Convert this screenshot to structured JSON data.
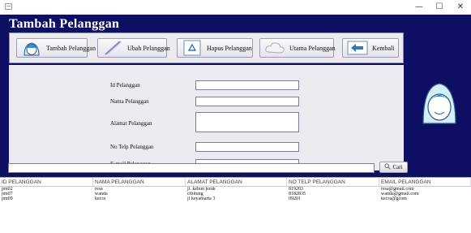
{
  "window": {
    "minimize": "—",
    "maximize": "☐",
    "close": "✕"
  },
  "page_title": "Tambah Pelanggan",
  "toolbar": {
    "buttons": [
      {
        "label": "Tambah Pelanggan",
        "icon": "customer-avatar-icon"
      },
      {
        "label": "Ubah Pelanggan",
        "icon": "pencil-icon"
      },
      {
        "label": "Hapus Pelanggan",
        "icon": "recycle-icon"
      },
      {
        "label": "Utama Pelanggan",
        "icon": "cloud-icon"
      },
      {
        "label": "Kembali",
        "icon": "back-arrow-icon"
      }
    ]
  },
  "form": {
    "id_label": "Id Pelanggan",
    "name_label": "Nama Pelanggan",
    "address_label": "Alamat Pelanggan",
    "phone_label": "No Telp Pelanggan",
    "email_label": "E-mail Pelanggan",
    "id_value": "",
    "name_value": "",
    "address_value": "",
    "phone_value": "",
    "email_value": ""
  },
  "search": {
    "value": "",
    "button_label": "Cari",
    "button_icon": "search-icon"
  },
  "table": {
    "columns": [
      "ID PELANGGAN",
      "NAMA PELANGGAN",
      "ALAMAT PELANGGAN",
      "NO TELP PELANGGAN",
      "EMAIL PELANGGAN"
    ],
    "rows": [
      [
        "pm02",
        "resa",
        "jl. kebun jeruk",
        "819203",
        "resa@gmail.com"
      ],
      [
        "pm07",
        "wanda",
        "cibitung",
        "8182835",
        "wanda@gmail.com"
      ],
      [
        "pm09",
        "kecra",
        "jl keyamarta 3",
        "09201",
        "kecra@gcom"
      ]
    ]
  },
  "colors": {
    "background": "#0e0e63",
    "panel": "#ececf0",
    "title_text": "#ffffff"
  }
}
